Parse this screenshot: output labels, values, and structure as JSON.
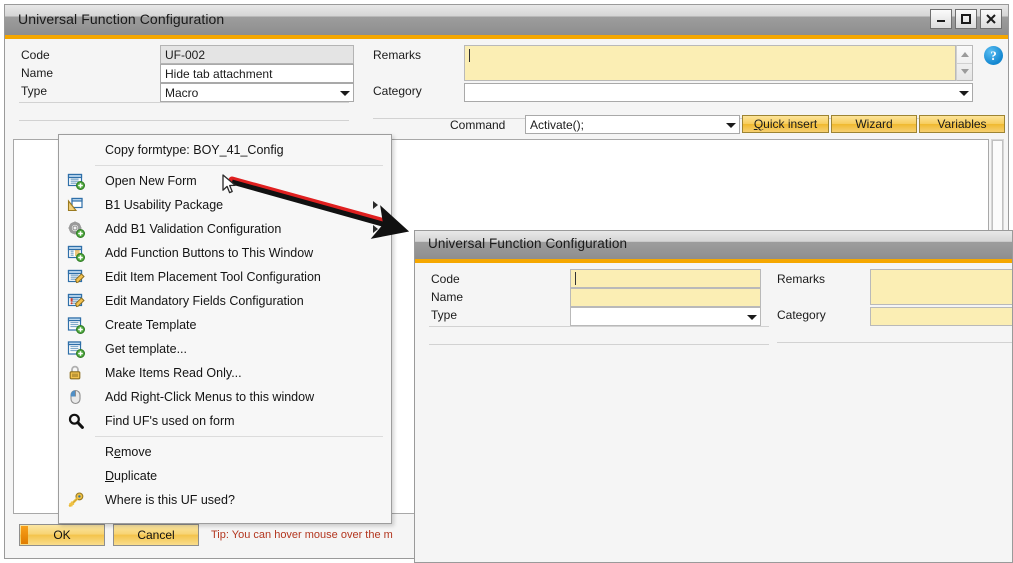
{
  "back_window": {
    "title": "Universal Function Configuration",
    "window_buttons": [
      {
        "name": "minimize",
        "glyph": "minimize-icon"
      },
      {
        "name": "maximize",
        "glyph": "maximize-icon"
      },
      {
        "name": "close",
        "glyph": "close-icon"
      }
    ],
    "fields": {
      "code_label": "Code",
      "code_value": "UF-002",
      "name_label": "Name",
      "name_value": "Hide tab attachment",
      "type_label": "Type",
      "type_value": "Macro",
      "remarks_label": "Remarks",
      "remarks_value": "",
      "category_label": "Category",
      "category_value": ""
    },
    "help_icon": "?",
    "command_row": {
      "label": "Command",
      "value": "Activate();",
      "quick_insert": "Quick insert",
      "quick_insert_accel": "Q",
      "wizard": "Wizard",
      "variables": "Variables"
    },
    "footer": {
      "ok": "OK",
      "cancel": "Cancel",
      "tip": "Tip: You can hover mouse over the m"
    }
  },
  "context_menu": {
    "items": [
      {
        "label": "Copy formtype: BOY_41_Config",
        "icon": null,
        "submenu": false,
        "separator_after": true
      },
      {
        "label": "Open New Form",
        "icon": "new-form-icon",
        "submenu": false,
        "separator_after": false
      },
      {
        "label": "B1 Usability Package",
        "icon": "usability-package-icon",
        "submenu": true,
        "separator_after": false
      },
      {
        "label": "Add B1 Validation Configuration",
        "icon": "validation-gear-icon",
        "submenu": true,
        "separator_after": false
      },
      {
        "label": "Add Function Buttons to This Window",
        "icon": "function-buttons-icon",
        "submenu": false,
        "separator_after": false
      },
      {
        "label": "Edit Item Placement Tool Configuration",
        "icon": "edit-placement-icon",
        "submenu": false,
        "separator_after": false
      },
      {
        "label": "Edit Mandatory Fields Configuration",
        "icon": "mandatory-fields-icon",
        "submenu": false,
        "separator_after": false
      },
      {
        "label": "Create Template",
        "icon": "create-template-icon",
        "submenu": false,
        "separator_after": false
      },
      {
        "label": "Get template...",
        "icon": "get-template-icon",
        "submenu": false,
        "separator_after": false
      },
      {
        "label": "Make Items Read Only...",
        "icon": "lock-icon",
        "submenu": false,
        "separator_after": false
      },
      {
        "label": "Add Right-Click Menus to this window",
        "icon": "mouse-icon",
        "submenu": false,
        "separator_after": false
      },
      {
        "label": "Find UF's used on form",
        "icon": "magnifier-icon",
        "submenu": false,
        "separator_after": true
      },
      {
        "label": "Remove",
        "icon": null,
        "submenu": false,
        "separator_after": false,
        "accel_index": 1
      },
      {
        "label": "Duplicate",
        "icon": null,
        "submenu": false,
        "separator_after": false,
        "accel_index": 0
      },
      {
        "label": "Where is this UF used?",
        "icon": "key-icon",
        "submenu": false,
        "separator_after": false
      }
    ]
  },
  "front_window": {
    "title": "Universal Function Configuration",
    "fields": {
      "code_label": "Code",
      "code_value": "",
      "name_label": "Name",
      "name_value": "",
      "type_label": "Type",
      "type_value": "",
      "remarks_label": "Remarks",
      "remarks_value": "",
      "category_label": "Category",
      "category_value": ""
    }
  },
  "colors": {
    "accent_orange": "#f5a700",
    "field_yellow": "#fbeeb4",
    "button_gold": "#f7d371",
    "tip_red": "#b3361f",
    "annotation_arrow": "#111111",
    "annotation_highlight": "#e02020"
  }
}
